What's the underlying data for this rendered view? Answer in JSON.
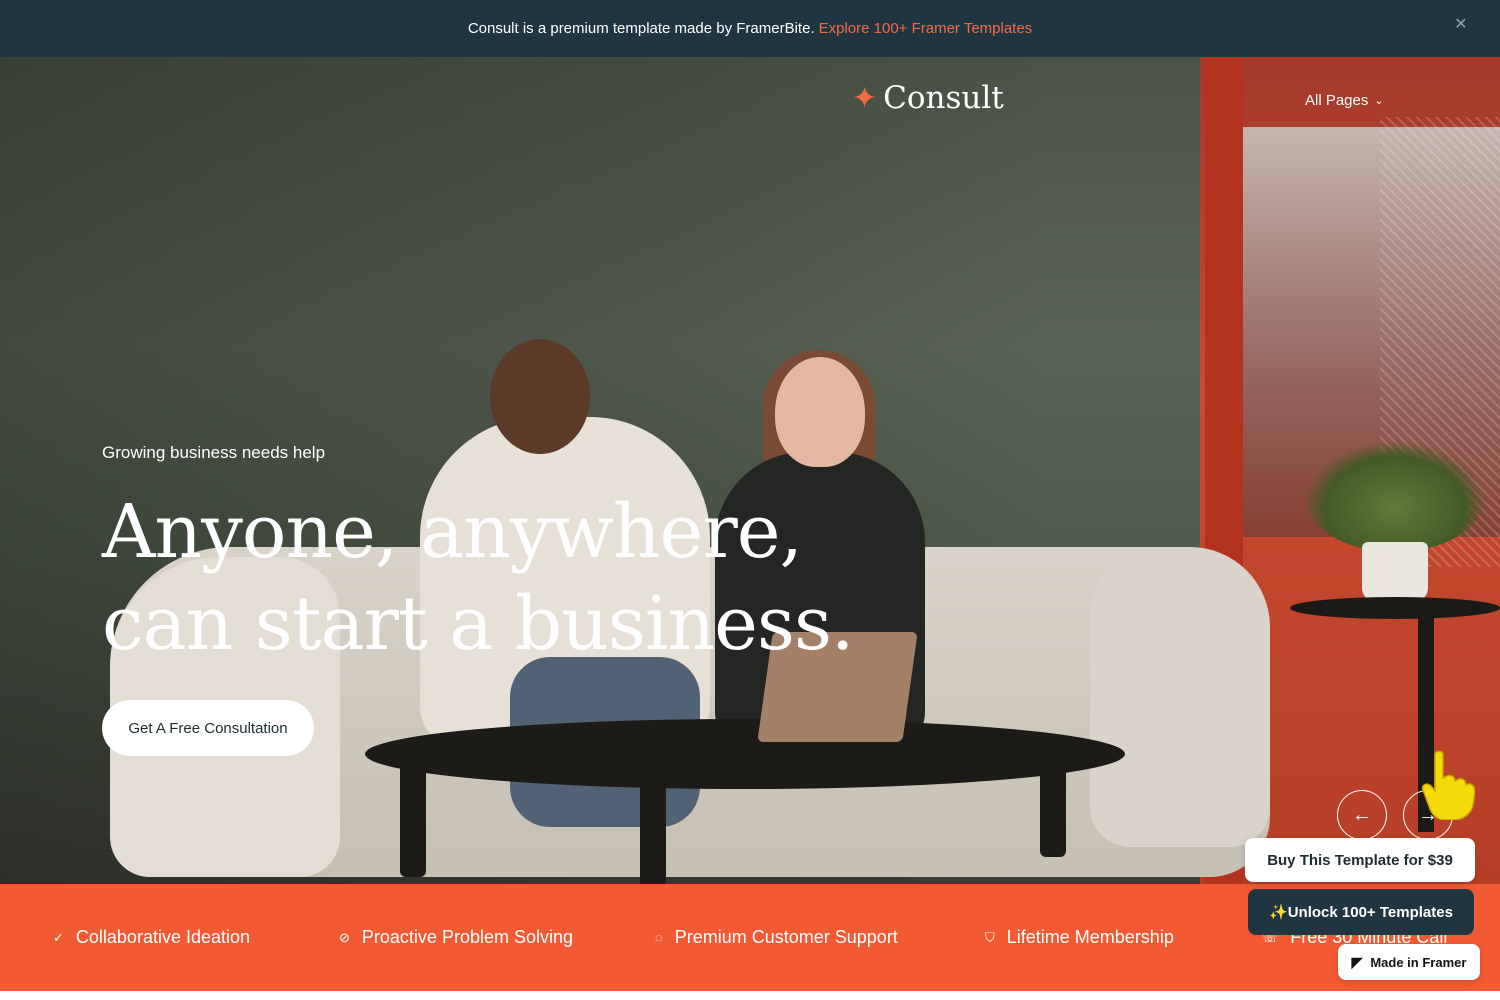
{
  "announcement": {
    "text": "Consult is a premium template made by FramerBite.",
    "link": "Explore 100+ Framer Templates",
    "close_icon": "close-icon"
  },
  "header": {
    "logo_text": "Consult",
    "logo_icon": "sparkle-star-icon",
    "nav": {
      "all_pages": "All Pages",
      "dropdown_icon": "chevron-down-icon"
    }
  },
  "hero": {
    "eyebrow": "Growing business needs help",
    "headline_line1": "Anyone, anywhere,",
    "headline_line2": "can start a business.",
    "cta": "Get A Free Consultation",
    "prev_icon": "arrow-left-icon",
    "next_icon": "arrow-right-icon"
  },
  "features": [
    {
      "label": "Collaborative Ideation",
      "icon": "check-icon"
    },
    {
      "label": "Proactive Problem Solving",
      "icon": "check-circle-icon"
    },
    {
      "label": "Premium Customer Support",
      "icon": "chat-icon"
    },
    {
      "label": "Lifetime Membership",
      "icon": "shield-check-icon"
    },
    {
      "label": "Free 30 Minute Call",
      "icon": "phone-icon"
    }
  ],
  "promo": {
    "buy": "Buy This Template for $39",
    "unlock": "✨Unlock 100+ Templates",
    "framer": "Made in Framer"
  },
  "colors": {
    "accent": "#f25a34",
    "announcement_bg": "#1f3642",
    "link": "#f26b43"
  }
}
